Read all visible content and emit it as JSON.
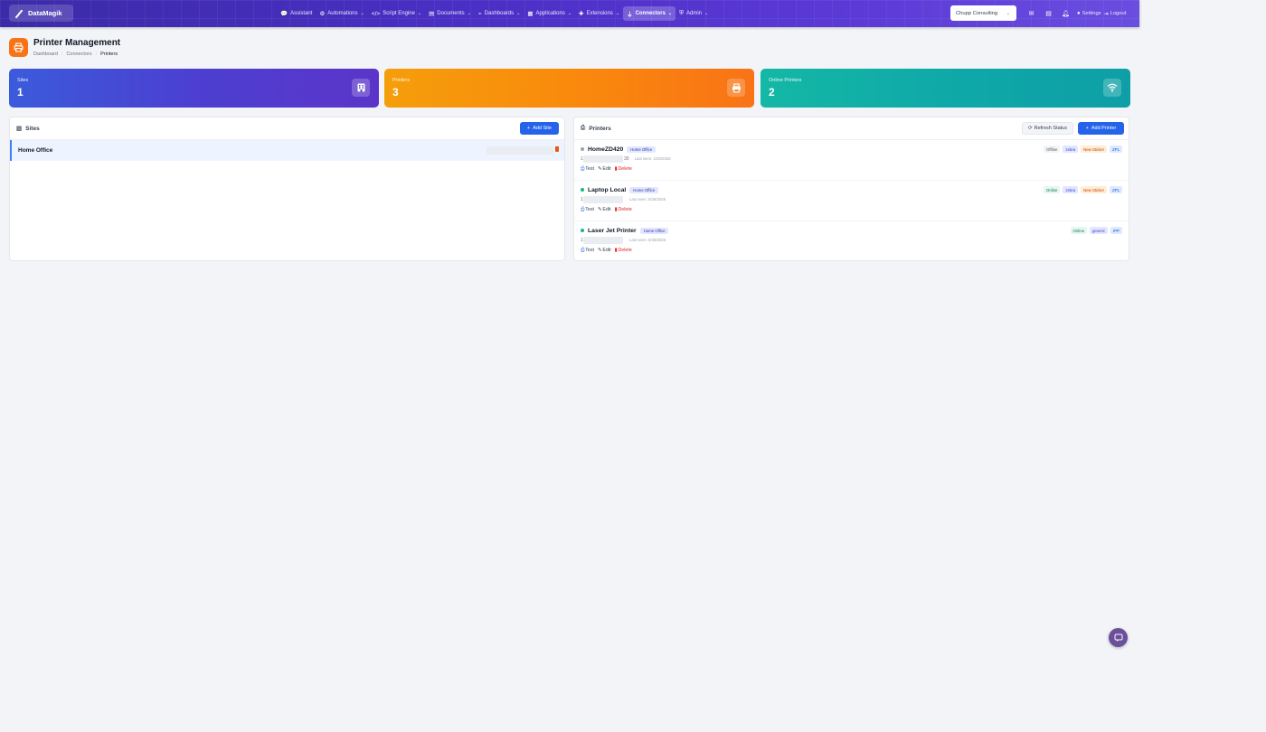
{
  "app": {
    "brand": "DataMagik"
  },
  "nav": {
    "items": [
      {
        "label": "Assistant",
        "icon": "chat-icon",
        "glyph": "💬",
        "dropdown": false
      },
      {
        "label": "Automations",
        "icon": "robot-icon",
        "glyph": "⚙",
        "dropdown": true
      },
      {
        "label": "Script Engine",
        "icon": "code-icon",
        "glyph": "</>",
        "dropdown": true
      },
      {
        "label": "Documents",
        "icon": "document-icon",
        "glyph": "▤",
        "dropdown": true
      },
      {
        "label": "Dashboards",
        "icon": "chart-icon",
        "glyph": "⌁",
        "dropdown": true
      },
      {
        "label": "Applications",
        "icon": "grid-icon",
        "glyph": "▦",
        "dropdown": true
      },
      {
        "label": "Extensions",
        "icon": "puzzle-icon",
        "glyph": "✚",
        "dropdown": true
      },
      {
        "label": "Connectors",
        "icon": "plug-icon",
        "glyph": "⏚",
        "dropdown": true,
        "active": true
      },
      {
        "label": "Admin",
        "icon": "shield-icon",
        "glyph": "⛨",
        "dropdown": true
      }
    ],
    "org": "Chupp Consulting",
    "settings": "Settings",
    "logout": "Logout"
  },
  "page": {
    "title": "Printer Management",
    "breadcrumb": [
      "Dashboard",
      "Connectors",
      "Printers"
    ]
  },
  "stats": [
    {
      "label": "Sites",
      "value": "1",
      "icon": "building-icon"
    },
    {
      "label": "Printers",
      "value": "3",
      "icon": "printer-icon"
    },
    {
      "label": "Online Printers",
      "value": "2",
      "icon": "wifi-icon"
    }
  ],
  "sites_panel": {
    "title": "Sites",
    "add_label": "Add Site",
    "sites": [
      {
        "name": "Home Office"
      }
    ]
  },
  "printers_panel": {
    "title": "Printers",
    "refresh_label": "Refresh Status",
    "add_label": "Add Printer",
    "actions": {
      "test": "Test",
      "edit": "Edit",
      "delete": "Delete"
    },
    "printers": [
      {
        "name": "HomeZD420",
        "site": "Home Office",
        "status": "Offline",
        "status_color": "#9ca3af",
        "addr_head": "1",
        "addr_tail": "30",
        "last_seen": "Last seen: 1/20/2026",
        "tags": [
          "Offline",
          "zebra",
          "New Sticker",
          "ZPL"
        ]
      },
      {
        "name": "Laptop Local",
        "site": "Home Office",
        "status": "Online",
        "status_color": "#10b981",
        "addr_head": "1",
        "addr_tail": "",
        "last_seen": "Last seen: 5/28/2026",
        "tags": [
          "Online",
          "zebra",
          "New Sticker",
          "ZPL"
        ]
      },
      {
        "name": "Laser Jet Printer",
        "site": "Home Office",
        "status": "Online",
        "status_color": "#10b981",
        "addr_head": "1",
        "addr_tail": "",
        "last_seen": "Last seen: 5/28/2026",
        "tags": [
          "Online",
          "generic",
          "IPP"
        ]
      }
    ]
  },
  "colors": {
    "accent": "#2563eb",
    "nav": "#4a2fc4",
    "orange": "#f97316",
    "teal": "#14b8a6"
  }
}
